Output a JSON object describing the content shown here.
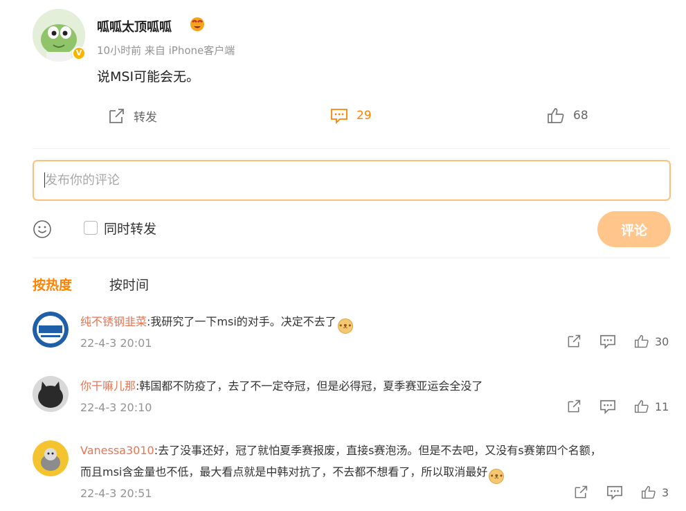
{
  "post": {
    "author": "呱呱太顶呱呱",
    "meta": "10小时前 来自 iPhone客户端",
    "text": "说MSI可能会无。",
    "actions": {
      "repost_label": "转发",
      "comment_count": "29",
      "like_count": "68"
    }
  },
  "composer": {
    "placeholder": "发布你的评论",
    "also_repost_label": "同时转发",
    "submit_label": "评论"
  },
  "sort_tabs": {
    "hot": "按热度",
    "time": "按时间"
  },
  "comments": [
    {
      "name": "纯不锈钢韭菜",
      "text": ":我研究了一下msi的对手。决定不去了",
      "time": "22-4-3 20:01",
      "likes": "30"
    },
    {
      "name": "你干嘛儿那",
      "text": ":韩国都不防疫了，去了不一定夺冠，但是必得冠，夏季赛亚运会全没了",
      "time": "22-4-3 20:10",
      "likes": "11"
    },
    {
      "name": "Vanessa3010",
      "text": ":去了没事还好，冠了就怕夏季赛报废，直接s赛泡汤。但是不去吧，又没有s赛第四个名额，",
      "text2": "而且msi含金量也不低，最大看点就是中韩对抗了，不去都不想看了，所以取消最好",
      "time": "22-4-3 20:51",
      "likes": "3"
    }
  ],
  "colors": {
    "accent": "#ff8200",
    "username": "#eb7350",
    "submit_bg": "#ffc58a",
    "input_border": "#ffbf78"
  }
}
